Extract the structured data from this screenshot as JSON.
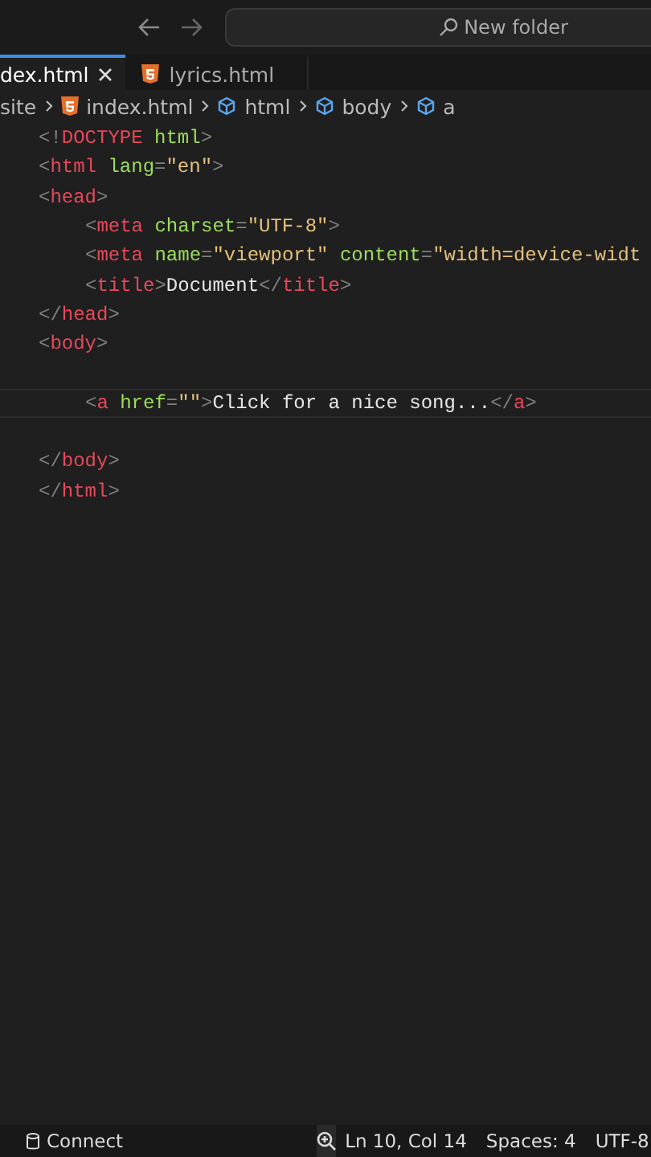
{
  "title_bar": {
    "search": "New folder"
  },
  "tabs": [
    {
      "label": "dex.html",
      "selected": true,
      "closable": true,
      "icon": false
    },
    {
      "label": "lyrics.html",
      "selected": false,
      "closable": false,
      "icon": true
    }
  ],
  "breadcrumb": [
    {
      "label": "site",
      "kind": "folder"
    },
    {
      "label": "index.html",
      "kind": "file"
    },
    {
      "label": "html",
      "kind": "symbol"
    },
    {
      "label": "body",
      "kind": "symbol"
    },
    {
      "label": "a",
      "kind": "symbol"
    }
  ],
  "code_lines": [
    {
      "kind": "top",
      "current": false,
      "tokens": [
        {
          "kind": "punct",
          "text": "<!"
        },
        {
          "kind": "tag",
          "text": "DOCTYPE"
        },
        {
          "kind": "attr",
          "text": " html"
        },
        {
          "kind": "punct",
          "text": ">"
        }
      ]
    },
    {
      "kind": "top",
      "current": false,
      "tokens": [
        {
          "kind": "punct",
          "text": "<"
        },
        {
          "kind": "tag",
          "text": "html"
        },
        {
          "kind": "attr",
          "text": " lang"
        },
        {
          "kind": "punct",
          "text": "="
        },
        {
          "kind": "string",
          "text": "\"en\""
        },
        {
          "kind": "punct",
          "text": ">"
        }
      ]
    },
    {
      "kind": "top",
      "current": false,
      "tokens": [
        {
          "kind": "punct",
          "text": "<"
        },
        {
          "kind": "tag",
          "text": "head"
        },
        {
          "kind": "punct",
          "text": ">"
        }
      ]
    },
    {
      "kind": "nested",
      "current": false,
      "tokens": [
        {
          "kind": "punct",
          "text": "<"
        },
        {
          "kind": "tag",
          "text": "meta"
        },
        {
          "kind": "attr",
          "text": " charset"
        },
        {
          "kind": "punct",
          "text": "="
        },
        {
          "kind": "string",
          "text": "\"UTF-8\""
        },
        {
          "kind": "punct",
          "text": ">"
        }
      ]
    },
    {
      "kind": "nested",
      "current": false,
      "tokens": [
        {
          "kind": "punct",
          "text": "<"
        },
        {
          "kind": "tag",
          "text": "meta"
        },
        {
          "kind": "attr",
          "text": " name"
        },
        {
          "kind": "punct",
          "text": "="
        },
        {
          "kind": "string",
          "text": "\"viewport\""
        },
        {
          "kind": "attr",
          "text": " content"
        },
        {
          "kind": "punct",
          "text": "="
        },
        {
          "kind": "string",
          "text": "\"width=device-widt"
        }
      ]
    },
    {
      "kind": "nested",
      "current": false,
      "tokens": [
        {
          "kind": "punct",
          "text": "<"
        },
        {
          "kind": "tag",
          "text": "title"
        },
        {
          "kind": "punct",
          "text": ">"
        },
        {
          "kind": "text",
          "text": "Document"
        },
        {
          "kind": "punct",
          "text": "</"
        },
        {
          "kind": "tag",
          "text": "title"
        },
        {
          "kind": "punct",
          "text": ">"
        }
      ]
    },
    {
      "kind": "top",
      "current": false,
      "tokens": [
        {
          "kind": "punct",
          "text": "</"
        },
        {
          "kind": "tag",
          "text": "head"
        },
        {
          "kind": "punct",
          "text": ">"
        }
      ]
    },
    {
      "kind": "top",
      "current": false,
      "tokens": [
        {
          "kind": "punct",
          "text": "<"
        },
        {
          "kind": "tag",
          "text": "body"
        },
        {
          "kind": "punct",
          "text": ">"
        }
      ]
    },
    {
      "kind": "blank",
      "current": false
    },
    {
      "kind": "nested",
      "current": true,
      "tokens": [
        {
          "kind": "punct",
          "text": "<"
        },
        {
          "kind": "tag",
          "text": "a"
        },
        {
          "kind": "attr",
          "text": " href"
        },
        {
          "kind": "punct",
          "text": "="
        },
        {
          "kind": "string",
          "text": "\"\""
        },
        {
          "kind": "punct",
          "text": ">"
        },
        {
          "kind": "text",
          "text": "Click for a nice song..."
        },
        {
          "kind": "punct",
          "text": "</"
        },
        {
          "kind": "tag",
          "text": "a"
        },
        {
          "kind": "punct",
          "text": ">"
        }
      ]
    },
    {
      "kind": "blank",
      "current": false
    },
    {
      "kind": "top",
      "current": false,
      "tokens": [
        {
          "kind": "punct",
          "text": "</"
        },
        {
          "kind": "tag",
          "text": "body"
        },
        {
          "kind": "punct",
          "text": ">"
        }
      ]
    },
    {
      "kind": "top",
      "current": false,
      "tokens": [
        {
          "kind": "punct",
          "text": "</"
        },
        {
          "kind": "tag",
          "text": "html"
        },
        {
          "kind": "punct",
          "text": ">"
        }
      ]
    }
  ],
  "status_bar": {
    "connect": "Connect",
    "position": "Ln 10, Col 14",
    "spaces": "Spaces: 4",
    "encoding": "UTF-8"
  }
}
